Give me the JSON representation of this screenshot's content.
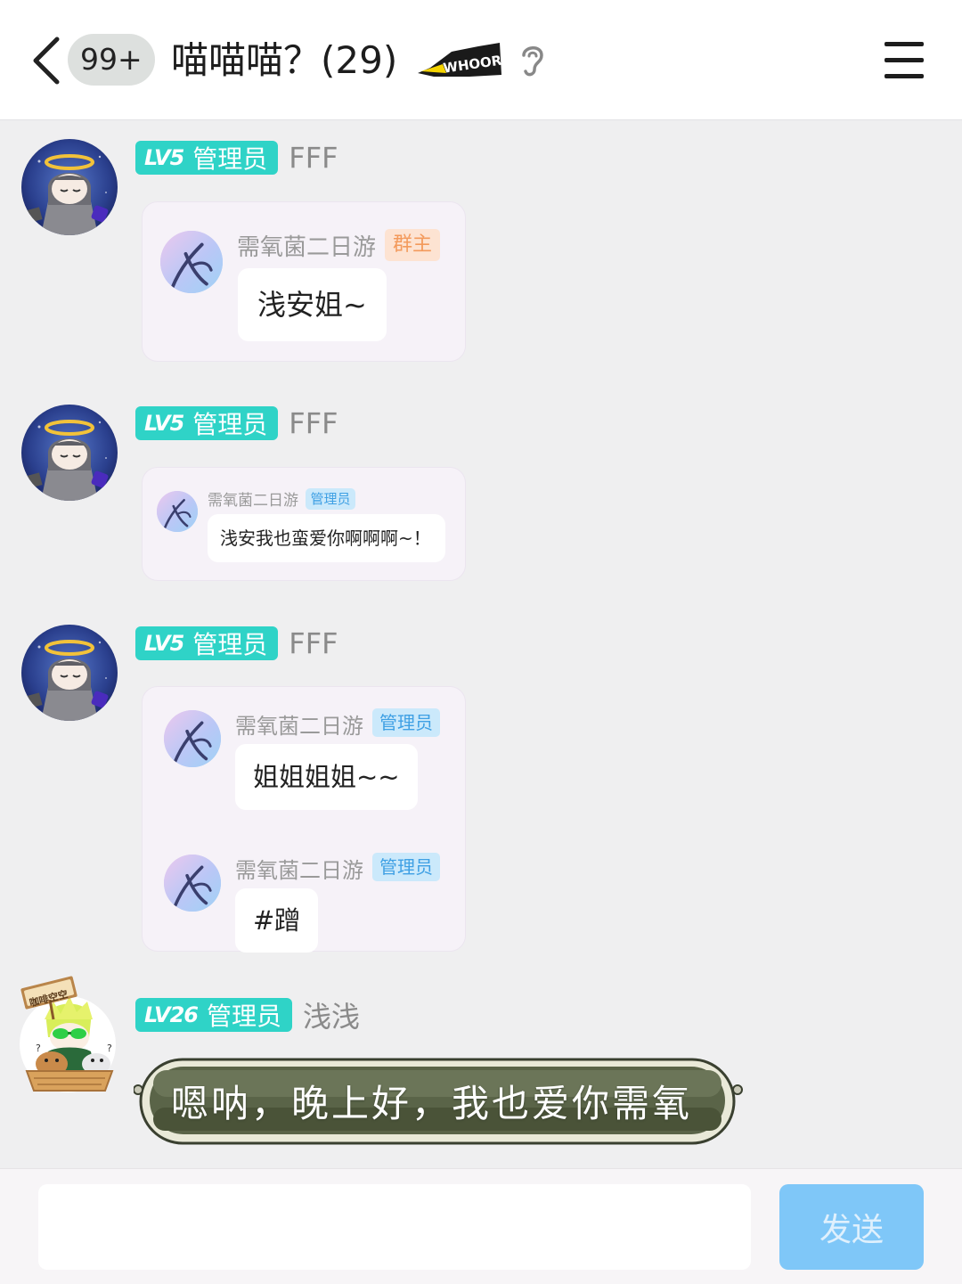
{
  "header": {
    "unread_badge": "99+",
    "title": "喵喵喵？(29)",
    "logo_text": "WHOORAY"
  },
  "messages": [
    {
      "level": "LV5",
      "role": "管理员",
      "nickname": "FFF",
      "forwarded": [
        {
          "name": "需氧菌二日游",
          "tag": "群主",
          "text": "浅安姐~"
        }
      ]
    },
    {
      "level": "LV5",
      "role": "管理员",
      "nickname": "FFF",
      "forwarded": [
        {
          "name": "需氧菌二日游",
          "tag": "管理员",
          "text": "浅安我也蛮爱你啊啊啊~！"
        }
      ]
    },
    {
      "level": "LV5",
      "role": "管理员",
      "nickname": "FFF",
      "forwarded": [
        {
          "name": "需氧菌二日游",
          "tag": "管理员",
          "text": "姐姐姐姐~~"
        },
        {
          "name": "需氧菌二日游",
          "tag": "管理员",
          "text": "#蹭"
        }
      ]
    },
    {
      "level": "LV26",
      "role": "管理员",
      "nickname": "浅浅",
      "sign_text": "咖啡空空",
      "text": "嗯呐，晚上好，我也爱你需氧"
    }
  ],
  "composer": {
    "input_value": "",
    "send_label": "发送"
  },
  "colors": {
    "level_badge": "#2fd3c7",
    "owner_tag": "#f39a5c",
    "admin_tag": "#3fa0e4",
    "send_button": "#7fc7f8"
  }
}
